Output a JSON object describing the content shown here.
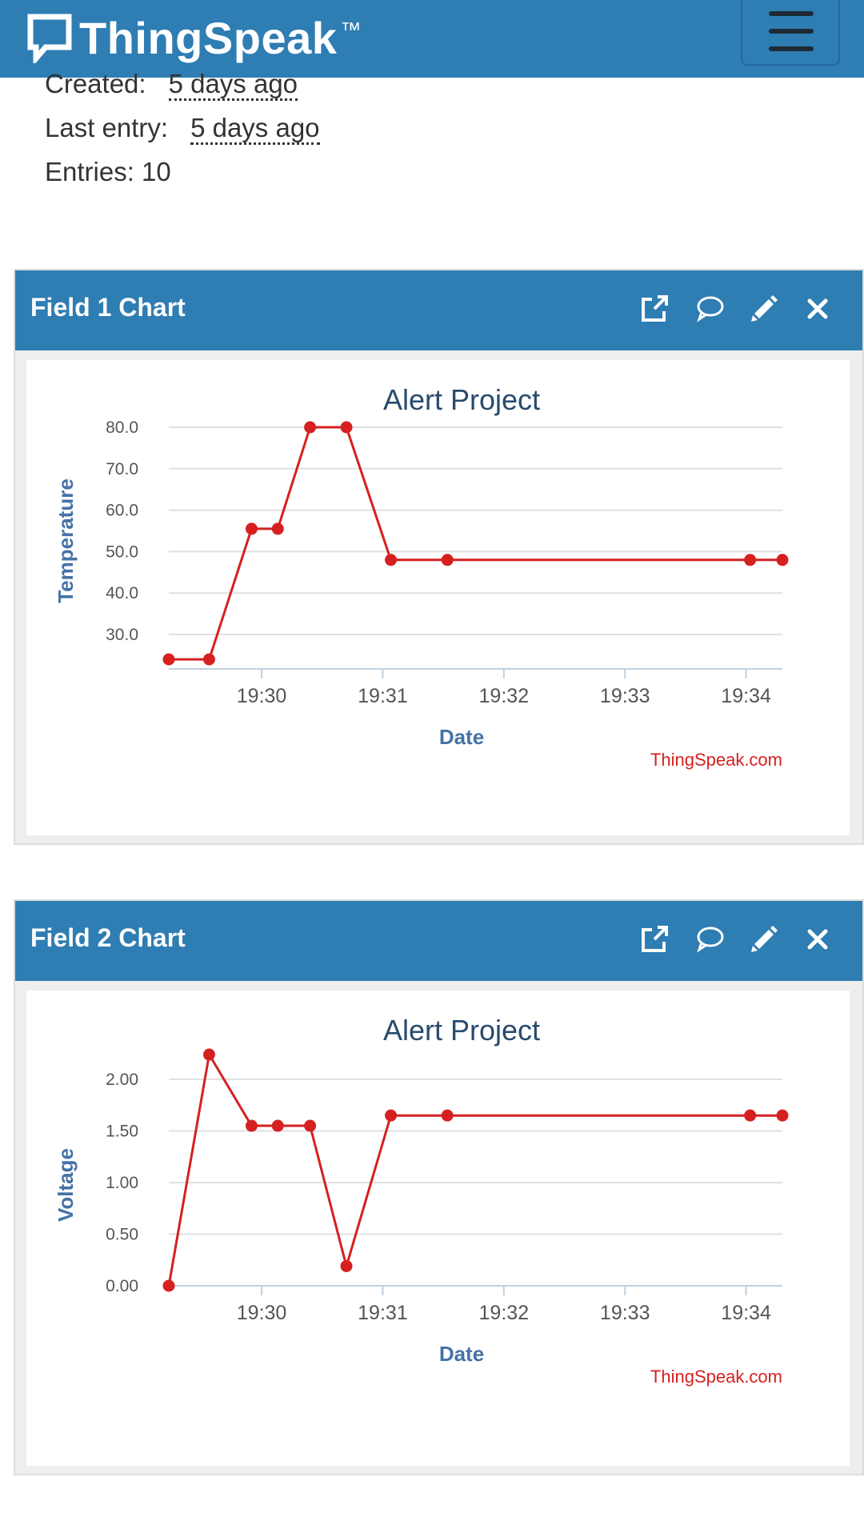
{
  "header": {
    "brand": "ThingSpeak",
    "trademark": "™",
    "menu_icon": "hamburger-menu-icon"
  },
  "channel_info": {
    "created_label": "Created:",
    "created_value": "5 days ago",
    "last_entry_label": "Last entry:",
    "last_entry_value": "5 days ago",
    "entries_text": "Entries: 10"
  },
  "colors": {
    "brand": "#2e7db3",
    "series": "#d62020",
    "axis_title": "#4572a7",
    "chart_title": "#274b6d"
  },
  "panels": [
    {
      "title": "Field 1 Chart",
      "icons": [
        "external-link-icon",
        "comment-icon",
        "pencil-icon",
        "close-icon"
      ],
      "chart_data": {
        "type": "line",
        "title": "Alert Project",
        "xlabel": "Date",
        "ylabel": "Temperature",
        "credits": "ThingSpeak.com",
        "x": [
          "19:29:14",
          "19:29:34",
          "19:29:55",
          "19:30:08",
          "19:30:24",
          "19:30:42",
          "19:31:04",
          "19:31:32",
          "19:34:02",
          "19:34:18"
        ],
        "values": [
          24.0,
          24.0,
          55.5,
          55.5,
          80.0,
          80.0,
          48.0,
          48.0,
          48.0,
          48.0
        ],
        "y_ticks": [
          "30.0",
          "40.0",
          "50.0",
          "60.0",
          "70.0",
          "80.0"
        ],
        "y_tick_values": [
          30,
          40,
          50,
          60,
          70,
          80
        ],
        "x_ticks": [
          "19:30",
          "19:31",
          "19:32",
          "19:33",
          "19:34"
        ],
        "x_tick_values": [
          "19:30:00",
          "19:31:00",
          "19:32:00",
          "19:33:00",
          "19:34:00"
        ],
        "xlim": [
          "19:29:14",
          "19:34:18"
        ],
        "ylim": [
          21,
          80
        ],
        "grid": true,
        "color": "#d62020"
      }
    },
    {
      "title": "Field 2 Chart",
      "icons": [
        "external-link-icon",
        "comment-icon",
        "pencil-icon",
        "close-icon"
      ],
      "chart_data": {
        "type": "line",
        "title": "Alert Project",
        "xlabel": "Date",
        "ylabel": "Voltage",
        "credits": "ThingSpeak.com",
        "x": [
          "19:29:14",
          "19:29:34",
          "19:29:55",
          "19:30:08",
          "19:30:24",
          "19:30:42",
          "19:31:04",
          "19:31:32",
          "19:34:02",
          "19:34:18"
        ],
        "values": [
          0.0,
          2.24,
          1.55,
          1.55,
          1.55,
          0.19,
          1.65,
          1.65,
          1.65,
          1.65
        ],
        "y_ticks": [
          "0.00",
          "0.50",
          "1.00",
          "1.50",
          "2.00"
        ],
        "y_tick_values": [
          0,
          0.5,
          1.0,
          1.5,
          2.0
        ],
        "x_ticks": [
          "19:30",
          "19:31",
          "19:32",
          "19:33",
          "19:34"
        ],
        "x_tick_values": [
          "19:30:00",
          "19:31:00",
          "19:32:00",
          "19:33:00",
          "19:34:00"
        ],
        "xlim": [
          "19:29:14",
          "19:34:18"
        ],
        "ylim": [
          0,
          2.24
        ],
        "grid": true,
        "color": "#d62020"
      }
    }
  ]
}
